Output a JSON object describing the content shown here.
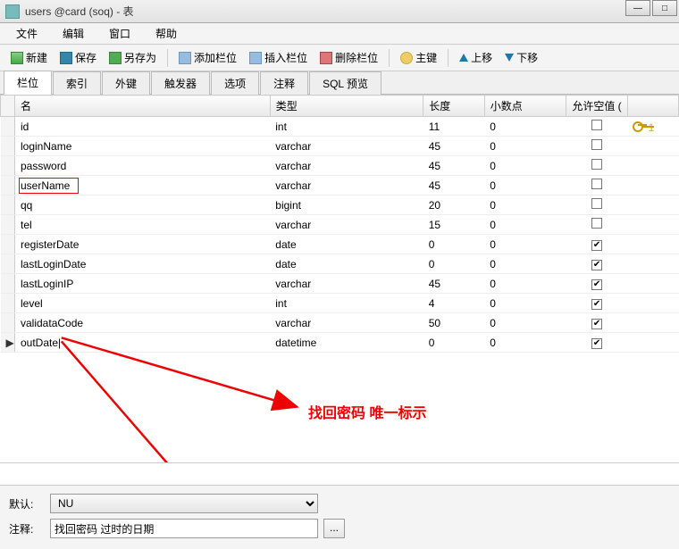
{
  "window": {
    "title": "users @card (soq) - 表"
  },
  "menu": [
    "文件",
    "编辑",
    "窗口",
    "帮助"
  ],
  "toolbar": {
    "new": "新建",
    "save": "保存",
    "save_as": "另存为",
    "add_col": "添加栏位",
    "insert_col": "插入栏位",
    "delete_col": "删除栏位",
    "primary_key": "主键",
    "move_up": "上移",
    "move_down": "下移"
  },
  "tabs": [
    "栏位",
    "索引",
    "外键",
    "触发器",
    "选项",
    "注释",
    "SQL 预览"
  ],
  "table": {
    "headers": {
      "name": "名",
      "type": "类型",
      "length": "长度",
      "decimals": "小数点",
      "allow_null": "允许空值 ("
    },
    "rows": [
      {
        "name": "id",
        "type": "int",
        "length": "11",
        "decimals": "0",
        "null": false,
        "key": "1"
      },
      {
        "name": "loginName",
        "type": "varchar",
        "length": "45",
        "decimals": "0",
        "null": false
      },
      {
        "name": "password",
        "type": "varchar",
        "length": "45",
        "decimals": "0",
        "null": false
      },
      {
        "name": "userName",
        "type": "varchar",
        "length": "45",
        "decimals": "0",
        "null": false,
        "highlight": true
      },
      {
        "name": "qq",
        "type": "bigint",
        "length": "20",
        "decimals": "0",
        "null": false
      },
      {
        "name": "tel",
        "type": "varchar",
        "length": "15",
        "decimals": "0",
        "null": false
      },
      {
        "name": "registerDate",
        "type": "date",
        "length": "0",
        "decimals": "0",
        "null": true
      },
      {
        "name": "lastLoginDate",
        "type": "date",
        "length": "0",
        "decimals": "0",
        "null": true
      },
      {
        "name": "lastLoginIP",
        "type": "varchar",
        "length": "45",
        "decimals": "0",
        "null": true
      },
      {
        "name": "level",
        "type": "int",
        "length": "4",
        "decimals": "0",
        "null": true
      },
      {
        "name": "validataCode",
        "type": "varchar",
        "length": "50",
        "decimals": "0",
        "null": true
      },
      {
        "name": "outDate",
        "type": "datetime",
        "length": "0",
        "decimals": "0",
        "null": true,
        "current": true
      }
    ]
  },
  "annotation": {
    "text": "找回密码 唯一标示"
  },
  "bottom": {
    "default_label": "默认:",
    "default_value": "NU",
    "comment_label": "注释:",
    "comment_value": "找回密码 过时的日期"
  }
}
